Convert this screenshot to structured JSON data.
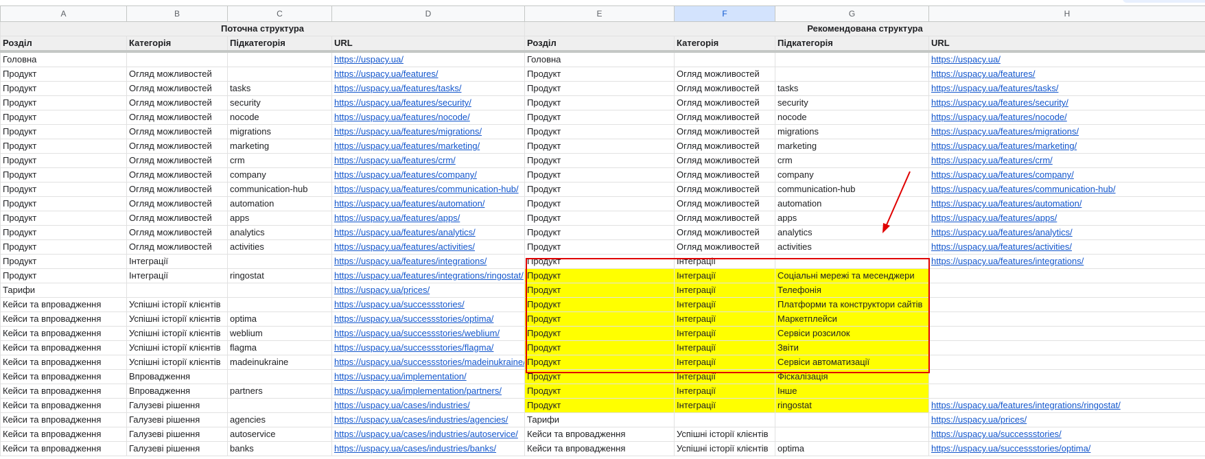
{
  "columns": [
    "A",
    "B",
    "C",
    "D",
    "E",
    "F",
    "G",
    "H"
  ],
  "group_headers": {
    "current": "Поточна структура",
    "recommended": "Рекомендована структура"
  },
  "headers": [
    "Розділ",
    "Категорія",
    "Підкатегорія",
    "URL",
    "Розділ",
    "Категорія",
    "Підкатегорія",
    "URL"
  ],
  "rows": [
    [
      "Головна",
      "",
      "",
      "https://uspacy.ua/",
      "Головна",
      "",
      "",
      "https://uspacy.ua/"
    ],
    [
      "Продукт",
      "Огляд можливостей",
      "",
      "https://uspacy.ua/features/",
      "Продукт",
      "Огляд можливостей",
      "",
      "https://uspacy.ua/features/"
    ],
    [
      "Продукт",
      "Огляд можливостей",
      "tasks",
      "https://uspacy.ua/features/tasks/",
      "Продукт",
      "Огляд можливостей",
      "tasks",
      "https://uspacy.ua/features/tasks/"
    ],
    [
      "Продукт",
      "Огляд можливостей",
      "security",
      "https://uspacy.ua/features/security/",
      "Продукт",
      "Огляд можливостей",
      "security",
      "https://uspacy.ua/features/security/"
    ],
    [
      "Продукт",
      "Огляд можливостей",
      "nocode",
      "https://uspacy.ua/features/nocode/",
      "Продукт",
      "Огляд можливостей",
      "nocode",
      "https://uspacy.ua/features/nocode/"
    ],
    [
      "Продукт",
      "Огляд можливостей",
      "migrations",
      "https://uspacy.ua/features/migrations/",
      "Продукт",
      "Огляд можливостей",
      "migrations",
      "https://uspacy.ua/features/migrations/"
    ],
    [
      "Продукт",
      "Огляд можливостей",
      "marketing",
      "https://uspacy.ua/features/marketing/",
      "Продукт",
      "Огляд можливостей",
      "marketing",
      "https://uspacy.ua/features/marketing/"
    ],
    [
      "Продукт",
      "Огляд можливостей",
      "crm",
      "https://uspacy.ua/features/crm/",
      "Продукт",
      "Огляд можливостей",
      "crm",
      "https://uspacy.ua/features/crm/"
    ],
    [
      "Продукт",
      "Огляд можливостей",
      "company",
      "https://uspacy.ua/features/company/",
      "Продукт",
      "Огляд можливостей",
      "company",
      "https://uspacy.ua/features/company/"
    ],
    [
      "Продукт",
      "Огляд можливостей",
      "communication-hub",
      "https://uspacy.ua/features/communication-hub/",
      "Продукт",
      "Огляд можливостей",
      "communication-hub",
      "https://uspacy.ua/features/communication-hub/"
    ],
    [
      "Продукт",
      "Огляд можливостей",
      "automation",
      "https://uspacy.ua/features/automation/",
      "Продукт",
      "Огляд можливостей",
      "automation",
      "https://uspacy.ua/features/automation/"
    ],
    [
      "Продукт",
      "Огляд можливостей",
      "apps",
      "https://uspacy.ua/features/apps/",
      "Продукт",
      "Огляд можливостей",
      "apps",
      "https://uspacy.ua/features/apps/"
    ],
    [
      "Продукт",
      "Огляд можливостей",
      "analytics",
      "https://uspacy.ua/features/analytics/",
      "Продукт",
      "Огляд можливостей",
      "analytics",
      "https://uspacy.ua/features/analytics/"
    ],
    [
      "Продукт",
      "Огляд можливостей",
      "activities",
      "https://uspacy.ua/features/activities/",
      "Продукт",
      "Огляд можливостей",
      "activities",
      "https://uspacy.ua/features/activities/"
    ],
    [
      "Продукт",
      "Інтеграції",
      "",
      "https://uspacy.ua/features/integrations/",
      "Продукт",
      "Інтеграції",
      "",
      "https://uspacy.ua/features/integrations/"
    ],
    [
      "Продукт",
      "Інтеграції",
      "ringostat",
      "https://uspacy.ua/features/integrations/ringostat/",
      "Продукт",
      "Інтеграції",
      "Соціальні мережі та месенджери",
      ""
    ],
    [
      "Тарифи",
      "",
      "",
      "https://uspacy.ua/prices/",
      "Продукт",
      "Інтеграції",
      "Телефонія",
      ""
    ],
    [
      "Кейси та впровадження",
      "Успішні історії клієнтів",
      "",
      "https://uspacy.ua/successstories/",
      "Продукт",
      "Інтеграції",
      "Платформи та конструктори сайтів",
      ""
    ],
    [
      "Кейси та впровадження",
      "Успішні історії клієнтів",
      "optima",
      "https://uspacy.ua/successstories/optima/",
      "Продукт",
      "Інтеграції",
      "Маркетплейси",
      ""
    ],
    [
      "Кейси та впровадження",
      "Успішні історії клієнтів",
      "weblium",
      "https://uspacy.ua/successstories/weblium/",
      "Продукт",
      "Інтеграції",
      "Сервіси розсилок",
      ""
    ],
    [
      "Кейси та впровадження",
      "Успішні історії клієнтів",
      "flagma",
      "https://uspacy.ua/successstories/flagma/",
      "Продукт",
      "Інтеграції",
      "Звіти",
      ""
    ],
    [
      "Кейси та впровадження",
      "Успішні історії клієнтів",
      "madeinukraine",
      "https://uspacy.ua/successstories/madeinukraine/",
      "Продукт",
      "Інтеграції",
      "Сервіси автоматизації",
      ""
    ],
    [
      "Кейси та впровадження",
      "Впровадження",
      "",
      "https://uspacy.ua/implementation/",
      "Продукт",
      "Інтеграції",
      "Фіскалізація",
      ""
    ],
    [
      "Кейси та впровадження",
      "Впровадження",
      "partners",
      "https://uspacy.ua/implementation/partners/",
      "Продукт",
      "Інтеграції",
      "Інше",
      ""
    ],
    [
      "Кейси та впровадження",
      "Галузеві рішення",
      "",
      "https://uspacy.ua/cases/industries/",
      "Продукт",
      "Інтеграції",
      "ringostat",
      "https://uspacy.ua/features/integrations/ringostat/"
    ],
    [
      "Кейси та впровадження",
      "Галузеві рішення",
      "agencies",
      "https://uspacy.ua/cases/industries/agencies/",
      "Тарифи",
      "",
      "",
      "https://uspacy.ua/prices/"
    ],
    [
      "Кейси та впровадження",
      "Галузеві рішення",
      "autoservice",
      "https://uspacy.ua/cases/industries/autoservice/",
      "Кейси та впровадження",
      "Успішні історії клієнтів",
      "",
      "https://uspacy.ua/successstories/"
    ],
    [
      "Кейси та впровадження",
      "Галузеві рішення",
      "banks",
      "https://uspacy.ua/cases/industries/banks/",
      "Кейси та впровадження",
      "Успішні історії клієнтів",
      "optima",
      "https://uspacy.ua/successstories/optima/"
    ]
  ],
  "highlight": {
    "color": "#ffff00",
    "row_from": 15,
    "row_to": 24,
    "col_from": 4,
    "col_to": 6
  },
  "selected_column": "F",
  "colors": {
    "link": "#1155cc",
    "annotation": "#e00000",
    "selected_header": "#d3e3fd"
  }
}
